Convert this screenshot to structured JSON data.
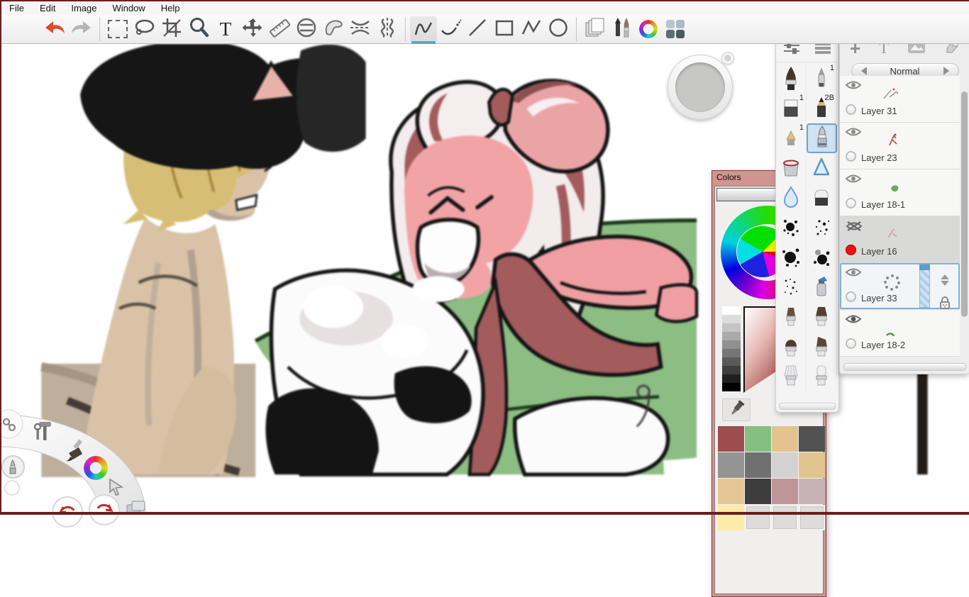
{
  "window": {
    "border_color": "#6b1d1d"
  },
  "menu": {
    "items": [
      "File",
      "Edit",
      "Image",
      "Window",
      "Help"
    ]
  },
  "toolbar": {
    "selected_tool": "freehand-stroke",
    "accent_color": "#57a4d7",
    "icons": {
      "text_tool": "T"
    },
    "tools": [
      "undo",
      "redo",
      "select-marquee",
      "select-lasso",
      "crop",
      "zoom",
      "text",
      "transform",
      "ruler",
      "ellipse-guide",
      "french-curve",
      "symmetry-horizontal",
      "symmetry-vertical",
      "freehand-stroke",
      "steady-stroke",
      "line",
      "rectangle",
      "polyline",
      "ellipse",
      "layers-toggle",
      "brushes-toggle",
      "color-editor-toggle",
      "interface-toggle"
    ]
  },
  "brush_palette": {
    "selected_brush": "ink-pen",
    "accent_color": "#6fa3cc",
    "badges": {
      "pen": "1",
      "eraser_hard": "1",
      "pencil": "2B",
      "marker": "1"
    }
  },
  "colors_panel": {
    "title": "Colors",
    "frame_color": "#d19490",
    "swatches": [
      [
        "#9e4d4e",
        "#85c083",
        "#e3c48f",
        "#525252"
      ],
      [
        "#949494",
        "#707070",
        "#d2d2d2",
        "#e2c48e"
      ],
      [
        "#e3c693",
        "#3c3c3c",
        "#c09598",
        "#c7b2b6"
      ],
      [
        "#ffeaaa",
        "",
        "",
        ""
      ]
    ]
  },
  "layers_panel": {
    "header_icons": {
      "add": "+",
      "text_layer": "T"
    },
    "blend_mode": "Normal",
    "selection_color": "#7fb2d8",
    "layers": [
      {
        "name": "Layer 31",
        "visible": true,
        "active": false
      },
      {
        "name": "Layer 23",
        "visible": true,
        "active": false
      },
      {
        "name": "Layer 18-1",
        "visible": true,
        "active": false
      },
      {
        "name": "Layer 16",
        "visible": false,
        "active": false,
        "marker_color": "#e81414"
      },
      {
        "name": "Layer 33",
        "visible": true,
        "active": true
      },
      {
        "name": "Layer 18-2",
        "visible": true,
        "active": false
      }
    ]
  },
  "lagoon": {
    "items": [
      "links",
      "tools",
      "brush",
      "color-wheel",
      "cursor",
      "layers"
    ]
  }
}
